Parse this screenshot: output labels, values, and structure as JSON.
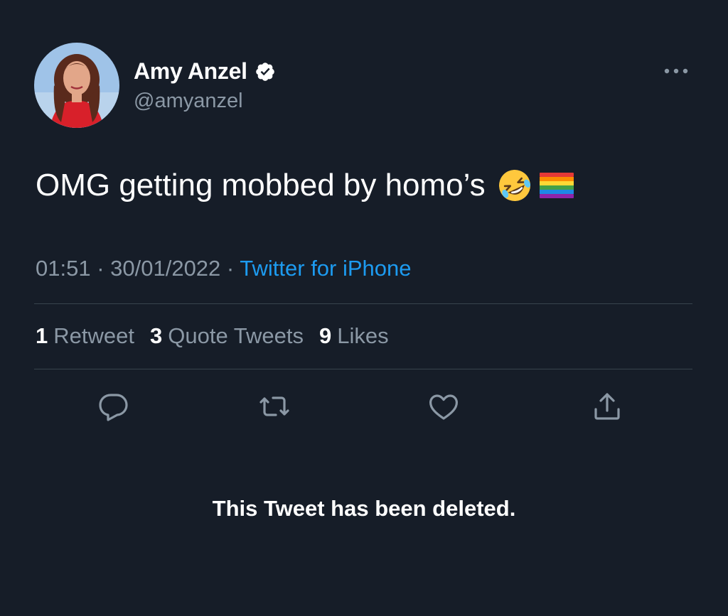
{
  "author": {
    "display_name": "Amy Anzel",
    "handle": "@amyanzel",
    "verified": true
  },
  "tweet": {
    "text": "OMG getting mobbed by homo’s",
    "emojis": [
      "rolling-on-floor-laughing-emoji",
      "rainbow-flag-emoji"
    ]
  },
  "meta": {
    "time": "01:51",
    "separator": " · ",
    "date": "30/01/2022",
    "source": "Twitter for iPhone"
  },
  "stats": {
    "retweets_count": "1",
    "retweets_label": "Retweet",
    "quotes_count": "3",
    "quotes_label": "Quote Tweets",
    "likes_count": "9",
    "likes_label": "Likes"
  },
  "actions": [
    "reply-icon",
    "retweet-icon",
    "like-icon",
    "share-icon"
  ],
  "notice": "This Tweet has been deleted.",
  "colors": {
    "background": "#161d28",
    "text": "#ffffff",
    "muted": "#8b98a5",
    "link": "#1d9bf0",
    "divider": "#38444d"
  }
}
